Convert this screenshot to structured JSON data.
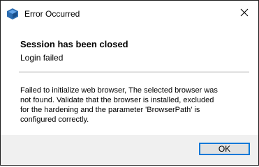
{
  "window": {
    "title": "Error Occurred",
    "icons": {
      "app": "app-logo-icon",
      "close": "close-icon"
    }
  },
  "content": {
    "heading": "Session has been closed",
    "subheading": "Login failed",
    "message_lines": [
      "Failed to initialize web browser, The selected browser was",
      "not found. Validate that the browser is installed, excluded",
      "for the hardening and the parameter 'BrowserPath' is",
      "configured correctly."
    ]
  },
  "buttons": {
    "ok_label": "OK"
  },
  "colors": {
    "accent": "#0078d7",
    "footer": "#f0f0f0",
    "divider": "#a0a0a0"
  }
}
